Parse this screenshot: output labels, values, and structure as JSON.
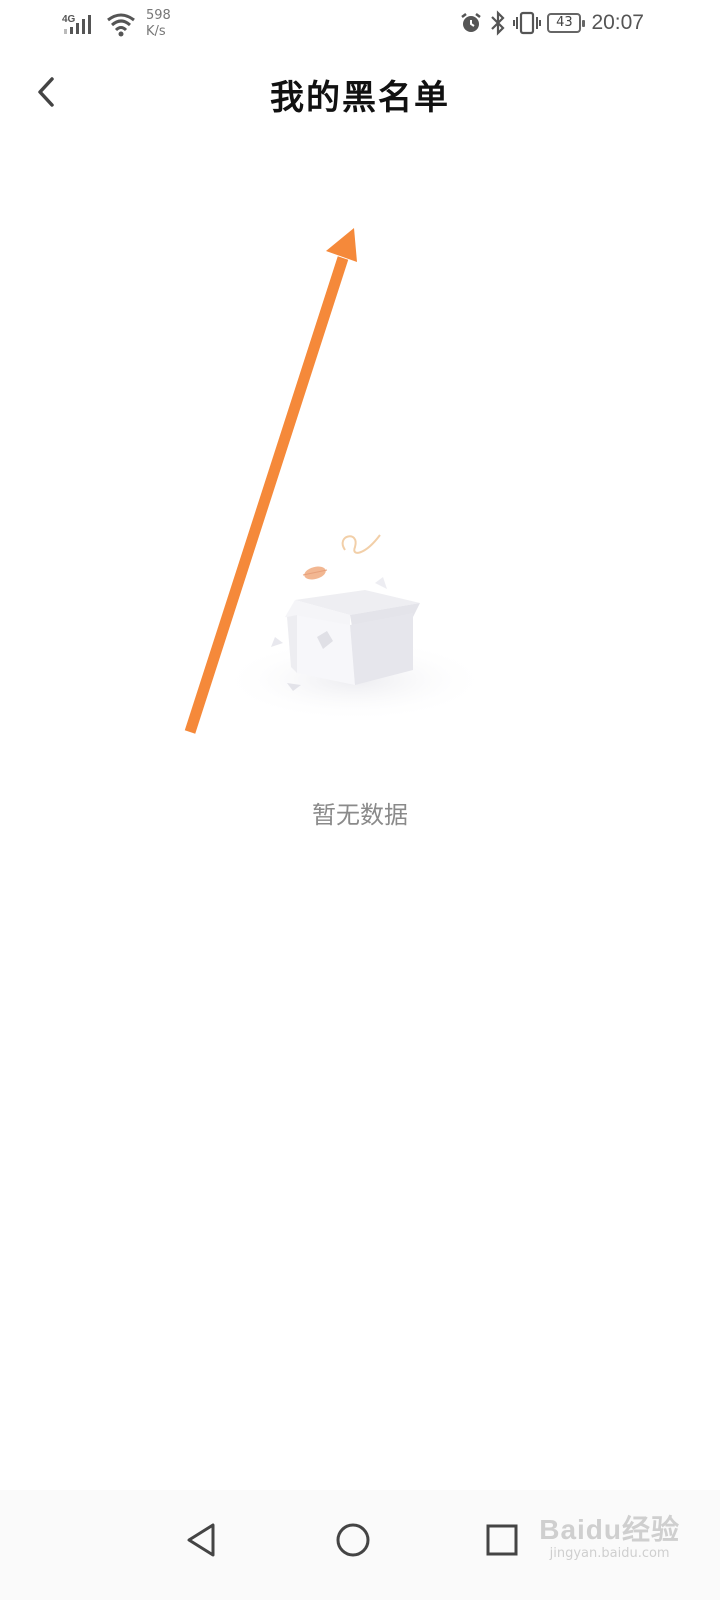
{
  "status_bar": {
    "network_type": "4G",
    "net_speed_value": "598",
    "net_speed_unit": "K/s",
    "battery": "43",
    "time": "20:07",
    "icons": [
      "signal-icon",
      "wifi-icon",
      "alarm-icon",
      "bluetooth-icon",
      "vibrate-icon",
      "battery-icon"
    ]
  },
  "header": {
    "title": "我的黑名单",
    "back_icon": "chevron-left-icon"
  },
  "empty_state": {
    "illustration": "empty-box-illustration",
    "message": "暂无数据"
  },
  "annotation": {
    "arrow_color": "#F5893A"
  },
  "nav_bar": {
    "back_icon": "triangle-back-icon",
    "home_icon": "circle-home-icon",
    "recents_icon": "square-recents-icon"
  },
  "watermark": {
    "main": "Baidu经验",
    "sub": "jingyan.baidu.com"
  }
}
